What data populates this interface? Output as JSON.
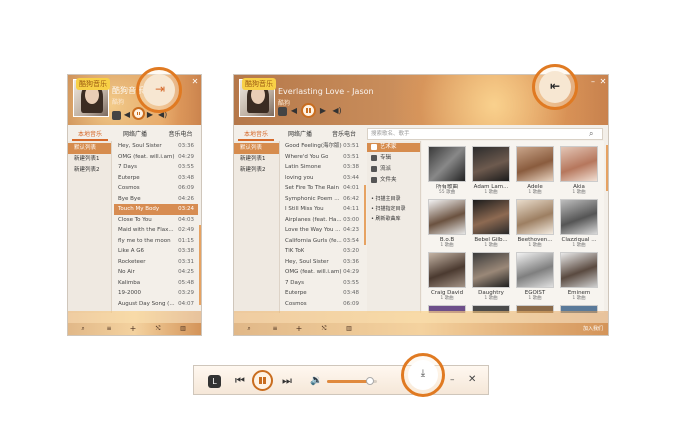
{
  "app": {
    "logo_text": "酷狗音乐"
  },
  "colors": {
    "accent": "#d6692a",
    "highlight_ring": "#e07a22",
    "header_orange": "#c88c5a",
    "panel_bg": "#f3efe9"
  },
  "small_player": {
    "song_title": "酷狗音乐",
    "song_sub": "酷狗",
    "tabs": [
      "本地音乐",
      "网络广播",
      "音乐电台"
    ],
    "sidebar": [
      "默认列表",
      "新建列表1",
      "新建列表2"
    ],
    "songs": [
      {
        "title": "Hey, Soul Sister",
        "dur": "03:36"
      },
      {
        "title": "OMG (feat. will.i.am)",
        "dur": "04:29"
      },
      {
        "title": "7 Days",
        "dur": "03:55"
      },
      {
        "title": "Euterpe",
        "dur": "03:48"
      },
      {
        "title": "Cosmos",
        "dur": "06:09"
      },
      {
        "title": "Bye Bye",
        "dur": "04:26"
      },
      {
        "title": "Touch My Body",
        "dur": "03:24"
      },
      {
        "title": "Close To You",
        "dur": "04:03"
      },
      {
        "title": "Maid with the Flax...",
        "dur": "02:49"
      },
      {
        "title": "fly me to the moon",
        "dur": "01:15"
      },
      {
        "title": "Like A G6",
        "dur": "03:38"
      },
      {
        "title": "Rocketeer",
        "dur": "03:31"
      },
      {
        "title": "No Air",
        "dur": "04:25"
      },
      {
        "title": "Kalimba",
        "dur": "05:48"
      },
      {
        "title": "19-2000",
        "dur": "03:29"
      },
      {
        "title": "August Day Song (...",
        "dur": "04:07"
      }
    ],
    "highlight_icon": "login-arrow-icon"
  },
  "big_player": {
    "song_title": "Everlasting Love - Jason",
    "song_sub": "酷狗",
    "tabs": [
      "本地音乐",
      "网络广播",
      "音乐电台"
    ],
    "sidebar": [
      "默认列表",
      "新建列表1",
      "新建列表2"
    ],
    "search_placeholder": "搜索歌名、歌手",
    "songs": [
      {
        "title": "Good Feeling(海尔版)",
        "dur": "03:51"
      },
      {
        "title": "Where'd You Go",
        "dur": "03:51"
      },
      {
        "title": "Latin Simone",
        "dur": "03:38"
      },
      {
        "title": "loving you",
        "dur": "03:44"
      },
      {
        "title": "Set Fire To The Rain",
        "dur": "04:01"
      },
      {
        "title": "Symphonic Poem ...",
        "dur": "06:42"
      },
      {
        "title": "I Still Miss You",
        "dur": "04:11"
      },
      {
        "title": "Airplanes (feat. Ha...",
        "dur": "03:00"
      },
      {
        "title": "Love the Way You ...",
        "dur": "04:23"
      },
      {
        "title": "California Gurls (fe...",
        "dur": "03:54"
      },
      {
        "title": "TiK ToK",
        "dur": "03:20"
      },
      {
        "title": "Hey, Soul Sister",
        "dur": "03:36"
      },
      {
        "title": "OMG (feat. will.i.am)",
        "dur": "04:29"
      },
      {
        "title": "7 Days",
        "dur": "03:55"
      },
      {
        "title": "Euterpe",
        "dur": "03:48"
      },
      {
        "title": "Cosmos",
        "dur": "06:09"
      }
    ],
    "categories": [
      "艺术家",
      "专辑",
      "流派",
      "文件夹"
    ],
    "scan_items": [
      "扫描主目录",
      "扫描指定目录",
      "刷新歌曲库"
    ],
    "artists": [
      {
        "name": "所有歌曲",
        "count": "55 歌曲"
      },
      {
        "name": "Adam Lam...",
        "count": "1 歌曲"
      },
      {
        "name": "Adele",
        "count": "1 歌曲"
      },
      {
        "name": "Akia",
        "count": "1 歌曲"
      },
      {
        "name": "B.o.B",
        "count": "1 歌曲"
      },
      {
        "name": "Bebel Gilb...",
        "count": "1 歌曲"
      },
      {
        "name": "Beethoven...",
        "count": "1 歌曲"
      },
      {
        "name": "Clazziqual ...",
        "count": "1 歌曲"
      },
      {
        "name": "Craig David",
        "count": "1 歌曲"
      },
      {
        "name": "Daughtry",
        "count": "1 歌曲"
      },
      {
        "name": "EGOIST",
        "count": "1 歌曲"
      },
      {
        "name": "Eminem",
        "count": "1 歌曲"
      }
    ],
    "bottom_right": "加入我们",
    "highlight_icon": "logout-arrow-icon"
  },
  "mini_bar": {
    "mode_label": "L",
    "volume_fraction": 0.85,
    "highlight_icon": "download-tray-icon"
  }
}
